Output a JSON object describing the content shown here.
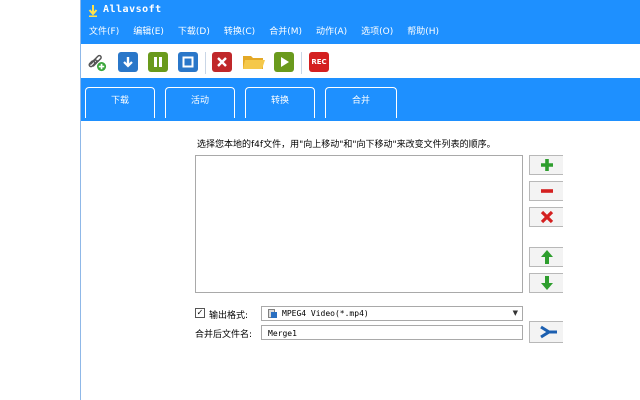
{
  "window": {
    "title": "Allavsoft"
  },
  "menu": [
    "文件(F)",
    "编辑(E)",
    "下载(D)",
    "转换(C)",
    "合并(M)",
    "动作(A)",
    "选项(O)",
    "帮助(H)"
  ],
  "toolbar": {
    "rec_label": "REC",
    "icons": [
      "link-add-icon",
      "download-icon",
      "pause-icon",
      "stop-icon",
      "delete-icon",
      "folder-icon",
      "play-icon",
      "rec-icon"
    ]
  },
  "tabs": [
    {
      "label": "下载",
      "active": false
    },
    {
      "label": "活动",
      "active": false
    },
    {
      "label": "转换",
      "active": false
    },
    {
      "label": "合并",
      "active": true
    }
  ],
  "merge": {
    "hint": "选择您本地的f4f文件，用\"向上移动\"和\"向下移动\"来改变文件列表的顺序。",
    "output_format_label": "输出格式:",
    "output_format_checked": true,
    "output_format_value": "MPEG4 Video(*.mp4)",
    "merged_filename_label": "合并后文件名:",
    "merged_filename_value": "Merge1",
    "side_buttons": [
      "add-icon",
      "remove-icon",
      "delete-icon",
      "move-up-icon",
      "move-down-icon"
    ]
  },
  "colors": {
    "accent": "#1e90ff",
    "green": "#2e9e2e",
    "red": "#d42020"
  }
}
